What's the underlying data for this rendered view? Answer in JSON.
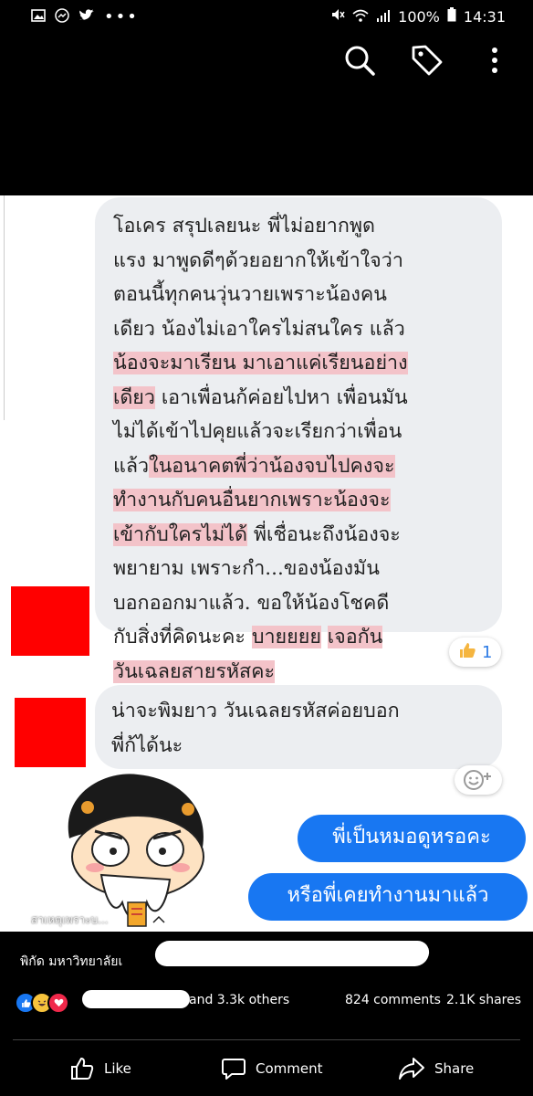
{
  "status_bar": {
    "battery": "100%",
    "time": "14:31"
  },
  "colors": {
    "highlight": "#f3c3c9",
    "messenger_blue": "#1877f2",
    "bubble_gray": "#eceef1",
    "redact": "#ff0000"
  },
  "chat": {
    "msg1": {
      "l1": "โอเคร สรุปเลยนะ พี่ไม่อยากพูด",
      "l2": "แรง มาพูดดีๆด้วยอยากให้เข้าใจว่า",
      "l3": "ตอนนี้ทุกคนวุ่นวายเพราะน้องคน",
      "l4": "เดียว น้องไม่เอาใครไม่สนใคร แล้ว",
      "l5": "น้องจะมาเรียน มาเอาแค่เรียนอย่าง",
      "l6a": "เดียว",
      "l6b": " เอาเพื่อนก้ค่อยไปหา เพื่อนมัน",
      "l7": "ไม่ได้เข้าไปคุยแล้วจะเรียกว่าเพื่อน",
      "l8a": "แล้ว",
      "l8b": "ในอนาคตพี่ว่าน้องจบไปคงจะ",
      "l9": "ทำงานกับคนอื่นยากเพราะน้องจะ",
      "l10a": "เข้ากับใครไม่ได้",
      "l10b": " พี่เชื่อนะถึงน้องจะ",
      "l11": "พยายาม เพราะกำ...ของน้องมัน",
      "l12": "บอกออกมาแล้ว. ขอให้น้องโชคดี",
      "l13a": "กับสิ่งที่คิดนะคะ ",
      "l13b": "บายยยย",
      "l13c": " ",
      "l13d": "เจอกัน",
      "l14": "วันเฉลยสายรหัสคะ"
    },
    "reaction_count": "1",
    "msg2": {
      "l1": "น่าจะพิมยาว วันเฉลยรหัสค่อยบอก",
      "l2": "พี่ก้ได้นะ"
    },
    "reply1": "พี่เป็นหมอดูหรอคะ",
    "reply2": "หรือพี่เคยทำงานมาแล้ว",
    "watermark": "สาเหตุเพราะบ..."
  },
  "post": {
    "location": "พิกัด มหาวิทยาลัยเ",
    "reactions_others": "and 3.3k others",
    "comments": "824 comments",
    "shares": "2.1K shares"
  },
  "actions": {
    "like": "Like",
    "comment": "Comment",
    "share": "Share"
  }
}
